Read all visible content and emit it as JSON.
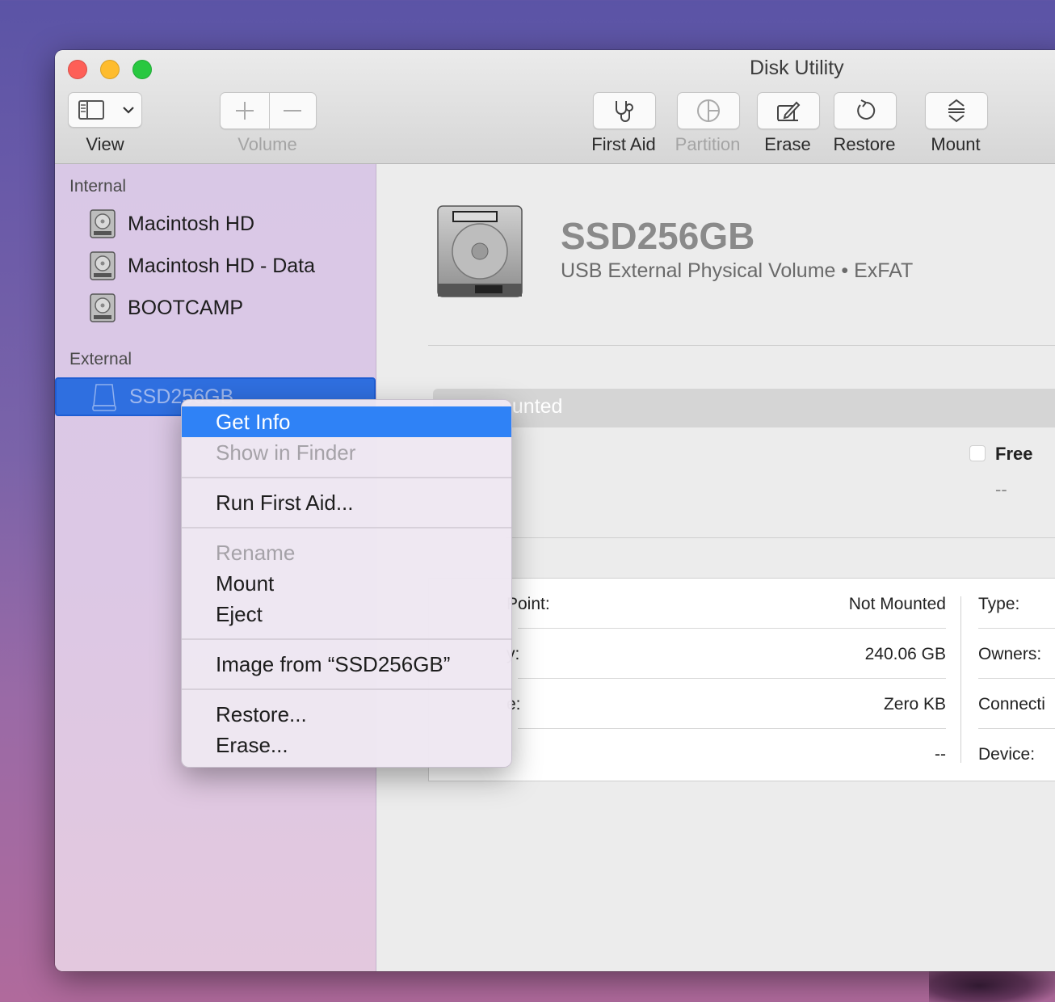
{
  "window": {
    "title": "Disk Utility"
  },
  "toolbar": {
    "view_label": "View",
    "volume_label": "Volume",
    "first_aid_label": "First Aid",
    "partition_label": "Partition",
    "erase_label": "Erase",
    "restore_label": "Restore",
    "mount_label": "Mount"
  },
  "sidebar": {
    "internal_header": "Internal",
    "internal_items": [
      "Macintosh HD",
      "Macintosh HD - Data",
      "BOOTCAMP"
    ],
    "external_header": "External",
    "external_items": [
      "SSD256GB"
    ]
  },
  "detail": {
    "volume_name": "SSD256GB",
    "volume_subtitle": "USB External Physical Volume • ExFAT",
    "mount_status_partial": "ounted",
    "free_label": "Free",
    "free_value": "--",
    "rows": [
      {
        "label_partial": "Point:",
        "value": "Not Mounted",
        "right_label": "Type:"
      },
      {
        "label_partial": "y:",
        "value": "240.06 GB",
        "right_label": "Owners:"
      },
      {
        "label_partial": "e:",
        "value": "Zero KB",
        "right_label": "Connecti"
      },
      {
        "label_partial": "",
        "value": "--",
        "right_label": "Device:"
      }
    ]
  },
  "context_menu": {
    "get_info": "Get Info",
    "show_in_finder": "Show in Finder",
    "run_first_aid": "Run First Aid...",
    "rename": "Rename",
    "mount": "Mount",
    "eject": "Eject",
    "image_from": "Image from “SSD256GB”",
    "restore": "Restore...",
    "erase": "Erase..."
  },
  "colors": {
    "menu_highlight": "#2f82f6",
    "sidebar_selection": "#2f6fe0",
    "close": "#fe5f57",
    "minimize": "#febc2e",
    "zoom": "#28c840"
  },
  "icons": {
    "view": "sidebar-icon",
    "view_dropdown": "chevron-down-icon",
    "add": "plus-icon",
    "remove": "minus-icon",
    "first_aid": "stethoscope-icon",
    "partition": "pie-chart-icon",
    "erase": "pencil-eraser-icon",
    "restore": "undo-arrow-icon",
    "mount": "mount-arrows-icon",
    "drive": "hard-drive-icon"
  }
}
